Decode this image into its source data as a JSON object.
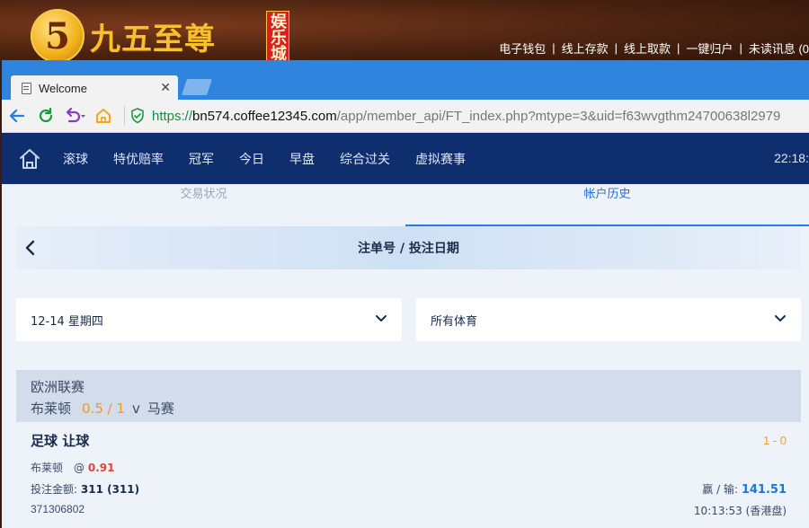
{
  "banner": {
    "logo_mark": "5",
    "brand": "九五至尊",
    "tag": "娱乐城",
    "links": [
      "电子钱包",
      "线上存款",
      "线上取款",
      "一键归户",
      "未读讯息 (0"
    ]
  },
  "browser": {
    "tab_title": "Welcome",
    "url_scheme": "https://",
    "url_host": "bn574.coffee12345.com",
    "url_path": "/app/member_api/FT_index.php?mtype=3&uid=f63wvgthm24700638l2979"
  },
  "nav": {
    "items": [
      "滚球",
      "特优赔率",
      "冠军",
      "今日",
      "早盘",
      "综合过关",
      "虚拟赛事"
    ],
    "clock": "22:18:"
  },
  "subtabs": {
    "left": "交易状况",
    "right": "帐户历史"
  },
  "title": "注单号 / 投注日期",
  "filters": {
    "date": "12-14 星期四",
    "sport": "所有体育"
  },
  "bet": {
    "league": "欧洲联赛",
    "home": "布莱顿",
    "handicap": "0.5 / 1",
    "vs": "v",
    "away": "马赛",
    "type": "足球 让球",
    "score": "1 - 0",
    "pick": "布莱顿",
    "at": "@",
    "odds": "0.91",
    "stake_label": "投注金额:",
    "stake": "311 (311)",
    "winlose_label": "赢 / 输:",
    "winlose": "141.51",
    "ticket_no": "371306802",
    "time": "10:13:53 (香港盘)"
  },
  "colors": {
    "nav_bg": "#0f2e6e",
    "accent_orange": "#f09a2a",
    "odds_red": "#e0453a",
    "win_blue": "#1a78d4"
  }
}
